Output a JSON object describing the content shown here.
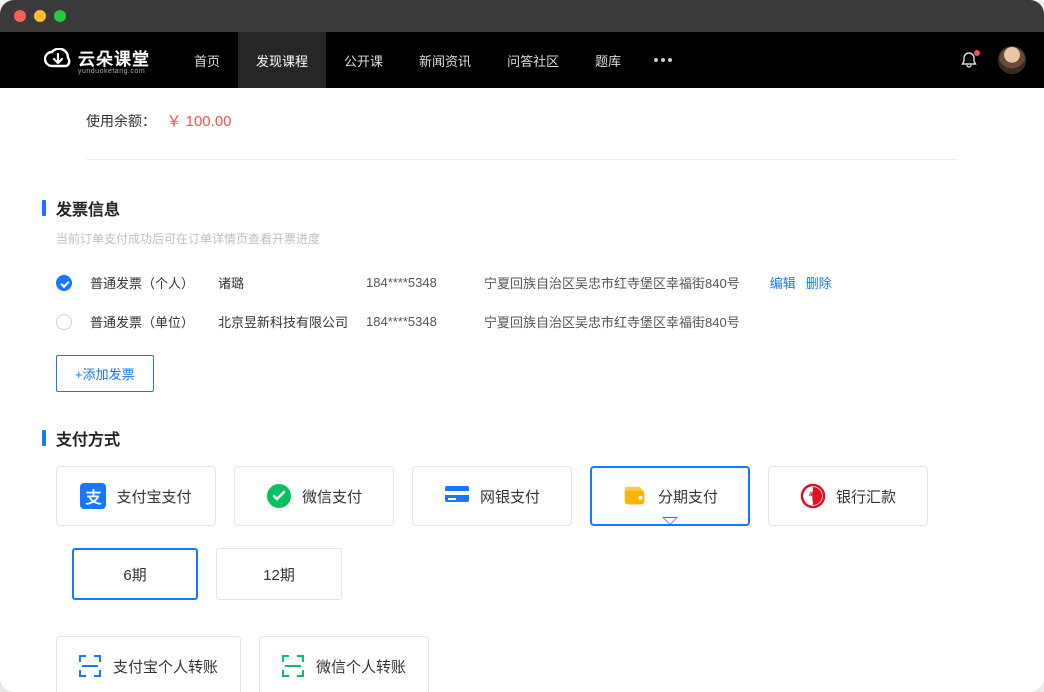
{
  "brand": {
    "name": "云朵课堂",
    "sub": "yunduoketang.com"
  },
  "nav": {
    "items": [
      "首页",
      "发现课程",
      "公开课",
      "新闻资讯",
      "问答社区",
      "题库"
    ],
    "active_index": 1
  },
  "balance": {
    "label": "使用余额：",
    "value": "￥ 100.00"
  },
  "invoice": {
    "title": "发票信息",
    "subtitle": "当前订单支付成功后可在订单详情页查看开票进度",
    "rows": [
      {
        "type": "普通发票（个人）",
        "name": "诸璐",
        "phone": "184****5348",
        "address": "宁夏回族自治区吴忠市红寺堡区幸福街840号",
        "selected": true,
        "ops": [
          "编辑",
          "删除"
        ]
      },
      {
        "type": "普通发票（单位）",
        "name": "北京昱新科技有限公司",
        "phone": "184****5348",
        "address": "宁夏回族自治区吴忠市红寺堡区幸福街840号",
        "selected": false,
        "ops": []
      }
    ],
    "add_label": "+添加发票"
  },
  "payment": {
    "title": "支付方式",
    "methods": [
      {
        "key": "alipay",
        "label": "支付宝支付"
      },
      {
        "key": "wechat",
        "label": "微信支付"
      },
      {
        "key": "bank",
        "label": "网银支付"
      },
      {
        "key": "install",
        "label": "分期支付",
        "selected": true
      },
      {
        "key": "remit",
        "label": "银行汇款"
      }
    ],
    "periods": [
      {
        "label": "6期",
        "selected": true
      },
      {
        "label": "12期",
        "selected": false
      }
    ],
    "transfers": [
      {
        "key": "alipay-tr",
        "label": "支付宝个人转账",
        "color": "#1677ff"
      },
      {
        "key": "wechat-tr",
        "label": "微信个人转账",
        "color": "#07c160"
      }
    ]
  }
}
